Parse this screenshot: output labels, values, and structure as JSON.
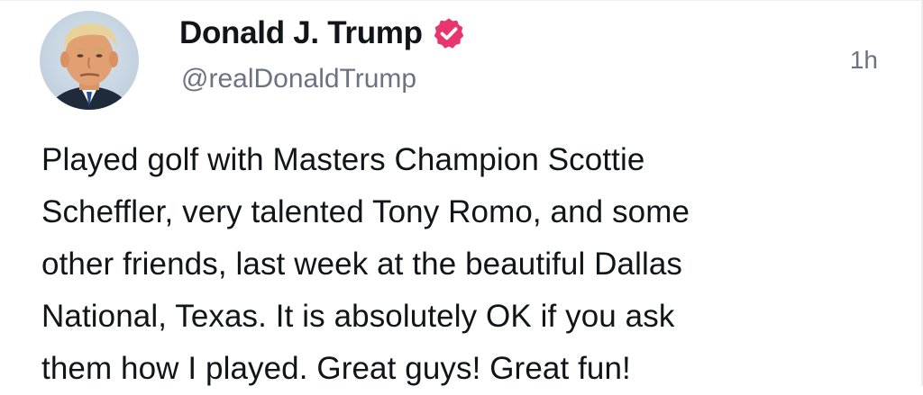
{
  "post": {
    "author": {
      "display_name": "Donald J. Trump",
      "handle": "@realDonaldTrump",
      "verified": true,
      "verified_badge_color": "#e8356d",
      "avatar_icon": "profile-photo"
    },
    "timestamp": "1h",
    "text_lines": [
      "Played golf with Masters Champion Scottie",
      "Scheffler, very talented Tony Romo, and some",
      "other friends, last week at the beautiful Dallas",
      "National, Texas. It is absolutely OK if you ask",
      "them how I played. Great guys! Great fun!"
    ]
  },
  "colors": {
    "text_primary": "#111418",
    "text_secondary": "#6b7280",
    "background": "#ffffff"
  }
}
